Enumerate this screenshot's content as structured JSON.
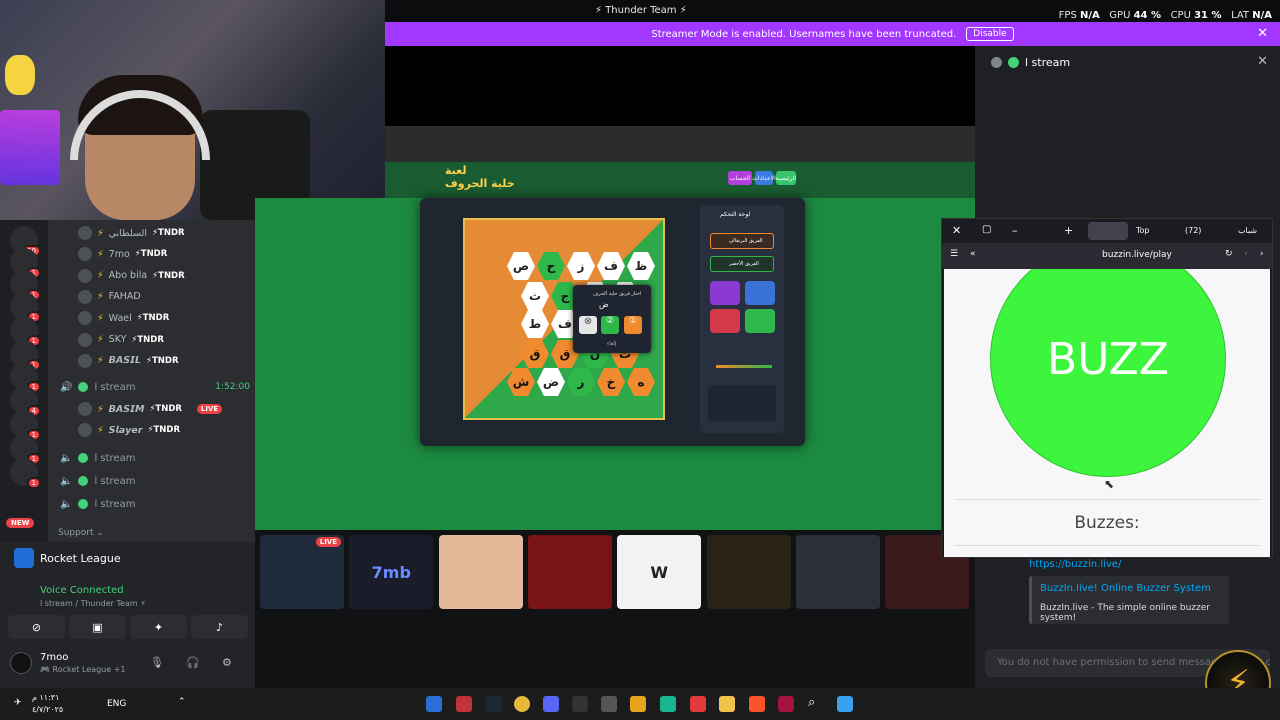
{
  "top_bar": {
    "title": "⚡ Thunder Team ⚡",
    "fps_label": "FPS",
    "fps_value": "N/A",
    "gpu_label": "GPU",
    "gpu_value": "44 %",
    "cpu_label": "CPU",
    "cpu_value": "31 %",
    "lat_label": "LAT",
    "lat_value": "N/A"
  },
  "streamer_banner": {
    "text": "Streamer Mode is enabled. Usernames have been truncated.",
    "disable_label": "Disable",
    "close": "✕"
  },
  "servers": [
    {
      "badge": "10"
    },
    {
      "badge": "1"
    },
    {
      "badge": "1"
    },
    {
      "badge": "1"
    },
    {
      "badge": "1"
    },
    {
      "badge": "1"
    },
    {
      "badge": "1"
    },
    {
      "badge": "4"
    },
    {
      "badge": "1"
    },
    {
      "badge": "1"
    },
    {
      "badge": "1"
    }
  ],
  "new_badge": "NEW",
  "voice_members_top": [
    {
      "name": "السلطاني",
      "tag": "⚡TNDR"
    },
    {
      "name": "7mo",
      "tag": "⚡TNDR"
    },
    {
      "name": "Abo bila",
      "tag": "⚡TNDR"
    },
    {
      "name": "FAHAD",
      "tag": ""
    },
    {
      "name": "Wael",
      "tag": "⚡TNDR"
    },
    {
      "name": "SKY",
      "tag": "⚡TNDR"
    },
    {
      "name": "𝘽𝘼𝙎𝙄𝙇",
      "tag": "⚡TNDR"
    }
  ],
  "stream_channel": {
    "name": "l stream",
    "time": "1:52:00"
  },
  "stream_members": [
    {
      "name": "𝘽𝘼𝙎𝙄𝙈",
      "tag": "⚡TNDR",
      "live": "LIVE"
    },
    {
      "name": "𝙎𝙡𝙖𝙮𝙚𝙧",
      "tag": "⚡TNDR"
    }
  ],
  "voice_channels": [
    "l stream",
    "l stream",
    "l stream"
  ],
  "support_label": "Support ⌄",
  "rocket_league": "Rocket League",
  "voice_connected": "Voice Connected",
  "voice_sub": "l stream / Thunder Team ⚡",
  "user": {
    "name": "7moo",
    "status": "🎮 Rocket League +1"
  },
  "game": {
    "logo_line1": "لعبة",
    "logo_line2": "خلية الحروف",
    "header_buttons": [
      "الرئيسية",
      "الاعدادات",
      "الحساب"
    ],
    "panel_title": "لوحة التحكم",
    "team_orange": "الفريق البرتقالي",
    "team_green": "الفريق الأخضر",
    "popup_title": "اختار فريق خلية الحرف",
    "popup_letter": "ض",
    "popup_ok": "إلغاء",
    "hexes": [
      [
        "ظ",
        "ف",
        "ز",
        "ح",
        "ص"
      ],
      [
        "ذ",
        "ك",
        "ج",
        "ث"
      ],
      [
        "ط",
        "د",
        "ف",
        "ط"
      ],
      [
        "ت",
        "ن",
        "ق",
        "ق"
      ],
      [
        "ه",
        "خ",
        "ر",
        "ض",
        "ش"
      ]
    ]
  },
  "thumbs": [
    {
      "label": "",
      "live": "LIVE"
    },
    {
      "label": "7mb"
    },
    {
      "label": ""
    },
    {
      "label": ""
    },
    {
      "label": "W"
    },
    {
      "label": ""
    },
    {
      "label": ""
    },
    {
      "label": ""
    }
  ],
  "right_panel": {
    "header": "l stream",
    "link": "https://buzzin.live/",
    "embed_title": "BuzzIn.live! Online Buzzer System",
    "embed_desc": "BuzzIn.live - The simple online buzzer system!",
    "perm_text": "You do not have permission to send messages in this channel."
  },
  "browser": {
    "tabs": [
      "Top",
      "(72)",
      "شباب"
    ],
    "url": "buzzin.live/play",
    "buzz_label": "BUZZ",
    "buzzes_label": "Buzzes:"
  },
  "taskbar": {
    "time": "١١:٣١ م",
    "date": "٤/٧/٢٠٢٥",
    "lang": "ENG"
  },
  "colors": {
    "accent": "#a238ff",
    "buzz": "#3df53d",
    "online": "#43d17a",
    "live": "#ed4245"
  }
}
